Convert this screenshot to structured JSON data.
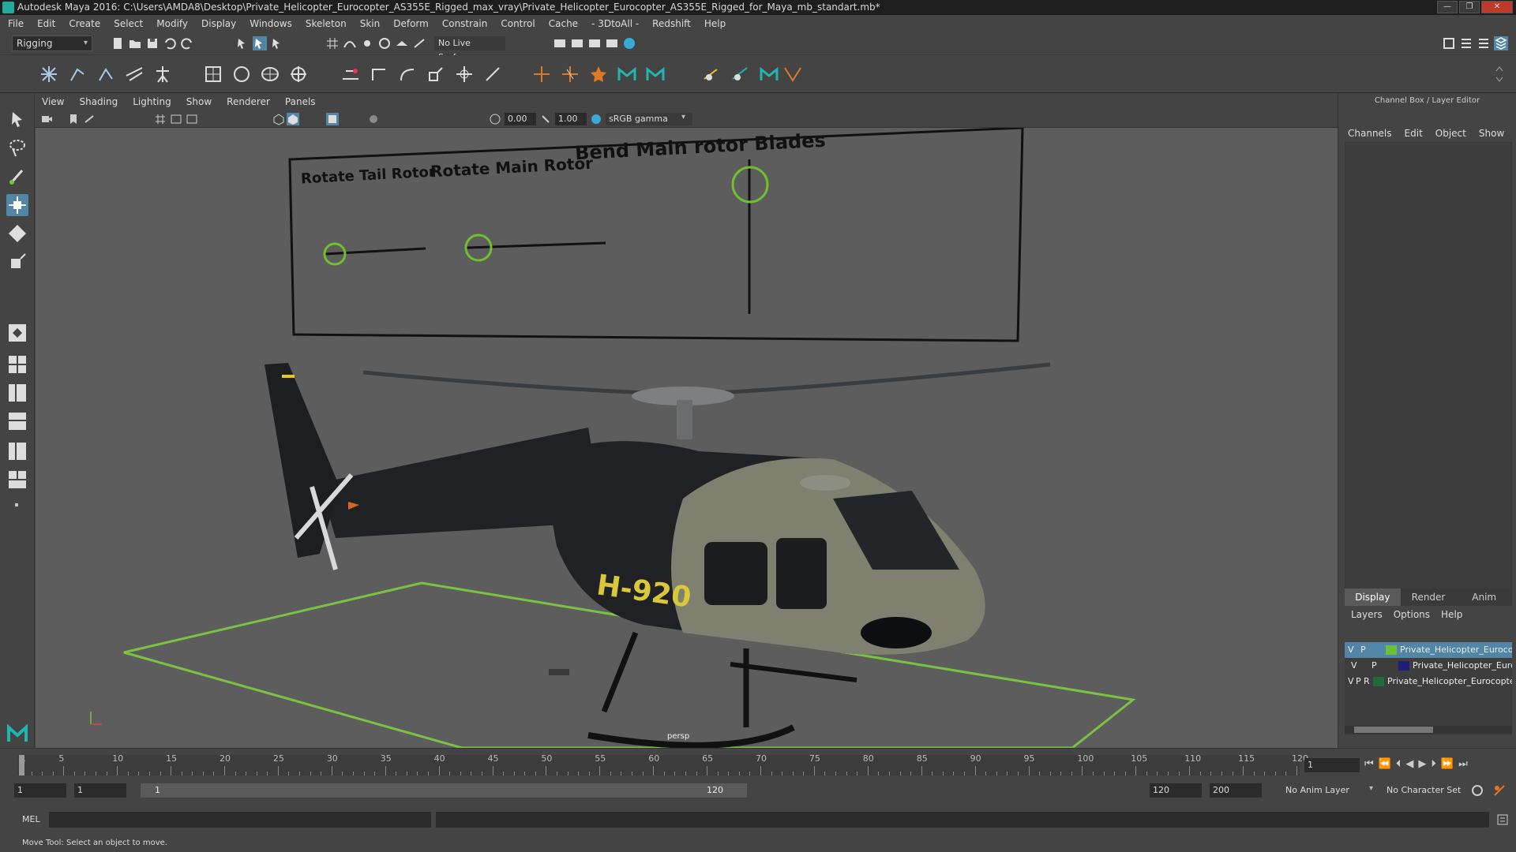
{
  "window": {
    "title": "Autodesk Maya 2016: C:\\Users\\AMDA8\\Desktop\\Private_Helicopter_Eurocopter_AS355E_Rigged_max_vray\\Private_Helicopter_Eurocopter_AS355E_Rigged_for_Maya_mb_standart.mb*",
    "minimize": "—",
    "maximize": "❐",
    "close": "✕"
  },
  "menubar": [
    "File",
    "Edit",
    "Create",
    "Select",
    "Modify",
    "Display",
    "Windows",
    "Skeleton",
    "Skin",
    "Deform",
    "Constrain",
    "Control",
    "Cache",
    "- 3DtoAll -",
    "Redshift",
    "Help"
  ],
  "statusline": {
    "mode": "Rigging",
    "live_surface": "No Live Surface"
  },
  "viewport_panel": {
    "menu": [
      "View",
      "Shading",
      "Lighting",
      "Show",
      "Renderer",
      "Panels"
    ],
    "exposure": "0.00",
    "gamma": "1.00",
    "color_space": "sRGB gamma",
    "camera": "persp",
    "controls": {
      "label_tail": "Rotate Tail Rotor",
      "label_main": "Rotate Main Rotor",
      "label_bend": "Bend Main rotor Blades"
    },
    "decal": "H-920"
  },
  "right_panel": {
    "title": "Channel Box / Layer Editor",
    "tabs": [
      "Channels",
      "Edit",
      "Object",
      "Show"
    ],
    "lower_tabs": [
      "Display",
      "Render",
      "Anim"
    ],
    "active_lower_tab": "Display",
    "layer_menu": [
      "Layers",
      "Options",
      "Help"
    ],
    "layers": [
      {
        "v": "V",
        "p": "P",
        "r": "",
        "name": "Private_Helicopter_Eurocopter",
        "color": "#6bbf3a",
        "selected": true
      },
      {
        "v": "V",
        "p": "P",
        "r": "",
        "name": "Private_Helicopter_Eurocopter",
        "color": "#1f1f7a",
        "selected": false
      },
      {
        "v": "V",
        "p": "P",
        "r": "R",
        "name": "Private_Helicopter_Eurocopter",
        "color": "#1f6b3a",
        "selected": false
      }
    ]
  },
  "timeslider": {
    "ticks": [
      "1",
      "5",
      "10",
      "15",
      "20",
      "25",
      "30",
      "35",
      "40",
      "45",
      "50",
      "55",
      "60",
      "65",
      "70",
      "75",
      "80",
      "85",
      "90",
      "95",
      "100",
      "105",
      "110",
      "115",
      "120"
    ],
    "current_frame": "1"
  },
  "rangeslider": {
    "start": "1",
    "inner_start": "1",
    "range_start": "1",
    "range_end": "120",
    "end": "120",
    "total_end": "200",
    "anim_layer": "No Anim Layer",
    "character_set": "No Character Set"
  },
  "cmdline": {
    "label": "MEL"
  },
  "helpline": {
    "text": "Move Tool: Select an object to move."
  },
  "colors": {
    "accent": "#5285a6",
    "ground": "#7cc242",
    "control_circle": "#6fbf2e",
    "fuselage": "#1f2124",
    "cabin": "#7f8070",
    "decal": "#d8c83a"
  }
}
